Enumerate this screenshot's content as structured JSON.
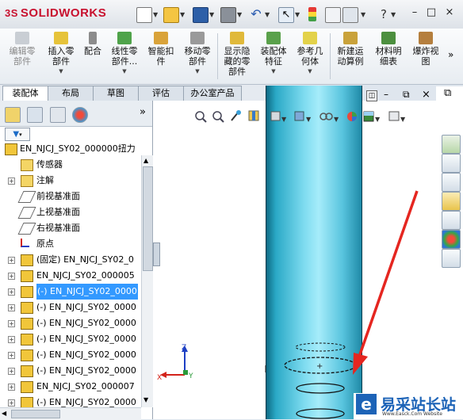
{
  "app": {
    "logo_text": "SOLIDWORKS",
    "logo_mark": "3S"
  },
  "window_controls": {
    "minimize": "–",
    "restore": "□",
    "close": "×"
  },
  "view_controls": {
    "tile": "◫",
    "minimize": "–",
    "restore": "⧉",
    "close": "×"
  },
  "toolbar": {
    "more": "»"
  },
  "commands": [
    {
      "label": "编辑零\n部件",
      "disabled": true,
      "icon": "edit-component-icon"
    },
    {
      "label": "插入零\n部件",
      "icon": "insert-component-icon"
    },
    {
      "label": "配合",
      "icon": "mate-icon"
    },
    {
      "label": "线性零\n部件...",
      "icon": "linear-pattern-icon"
    },
    {
      "label": "智能扣\n件",
      "icon": "smart-fastener-icon"
    },
    {
      "label": "移动零\n部件",
      "icon": "move-component-icon"
    },
    {
      "label": "显示隐\n藏的零\n部件",
      "icon": "show-hidden-icon"
    },
    {
      "label": "装配体\n特征",
      "icon": "assembly-feature-icon"
    },
    {
      "label": "参考几\n何体",
      "icon": "reference-geometry-icon"
    },
    {
      "label": "新建运\n动算例",
      "icon": "new-motion-study-icon"
    },
    {
      "label": "材料明\n细表",
      "icon": "bom-icon"
    },
    {
      "label": "爆炸视\n图",
      "icon": "exploded-view-icon"
    }
  ],
  "tabs": [
    "装配体",
    "布局",
    "草图",
    "评估",
    "办公室产品"
  ],
  "tree": {
    "root": "EN_NJCJ_SY02_000000扭力",
    "items": [
      {
        "label": "传感器",
        "expand": ""
      },
      {
        "label": "注解",
        "expand": "+"
      },
      {
        "label": "前视基准面",
        "expand": ""
      },
      {
        "label": "上视基准面",
        "expand": ""
      },
      {
        "label": "右视基准面",
        "expand": ""
      },
      {
        "label": "原点",
        "expand": ""
      },
      {
        "label": "(固定) EN_NJCJ_SY02_0",
        "expand": "+"
      },
      {
        "label": "EN_NJCJ_SY02_000005",
        "expand": "+"
      },
      {
        "label": "(-) EN_NJCJ_SY02_0000",
        "expand": "+",
        "selected": true
      },
      {
        "label": "(-) EN_NJCJ_SY02_0000",
        "expand": "+"
      },
      {
        "label": "(-) EN_NJCJ_SY02_0000",
        "expand": "+"
      },
      {
        "label": "(-) EN_NJCJ_SY02_0000",
        "expand": "+"
      },
      {
        "label": "(-) EN_NJCJ_SY02_0000",
        "expand": "+"
      },
      {
        "label": "(-) EN_NJCJ_SY02_0000",
        "expand": "+"
      },
      {
        "label": "EN_NJCJ_SY02_000007",
        "expand": "+"
      },
      {
        "label": "(-) EN_NJCJ_SY02_0000",
        "expand": "+"
      }
    ]
  },
  "triad": {
    "x": "X",
    "y": "Y",
    "z": "Z"
  },
  "watermark": {
    "logo": "e",
    "text": "易采站长站",
    "sub": "Www.Easck.Com Website"
  }
}
